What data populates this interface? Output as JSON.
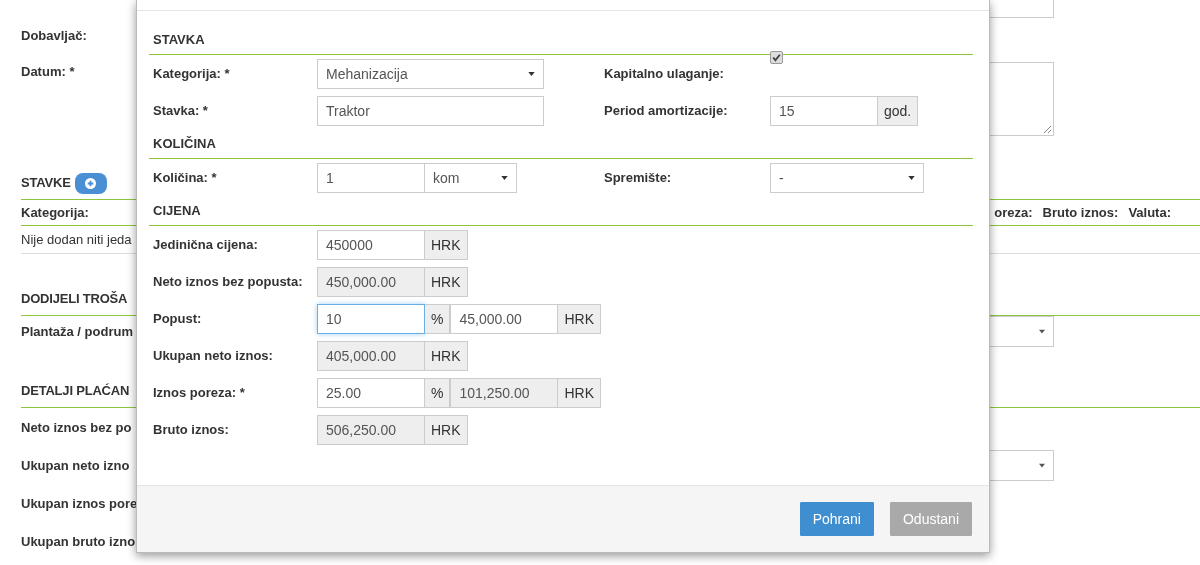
{
  "page": {
    "rows": [
      {
        "kind": "input"
      },
      {
        "kind": "label",
        "label": "Dobavljač:"
      },
      {
        "kind": "textarea",
        "label": "Datum: *"
      },
      {
        "kind": "heading",
        "title": "STAVKE",
        "add_button": true
      },
      {
        "kind": "columns",
        "columns": [
          "Kategorija:",
          "oreza:",
          "Bruto iznos:",
          "Valuta:"
        ]
      },
      {
        "kind": "empty",
        "text": "Nije dodan niti jeda"
      },
      {
        "kind": "heading",
        "title": "DODIJELI TROŠA"
      },
      {
        "kind": "select",
        "label": "Plantaža / podrum"
      },
      {
        "kind": "heading",
        "title": "DETALJI PLAĆAN"
      },
      {
        "kind": "label",
        "label": "Neto iznos bez po"
      },
      {
        "kind": "select",
        "label": "Ukupan neto izno"
      },
      {
        "kind": "label",
        "label": "Ukupan iznos pore"
      },
      {
        "kind": "label",
        "label": "Ukupan bruto izno"
      }
    ]
  },
  "modal": {
    "sections": [
      {
        "title": "STAVKA",
        "rows": [
          {
            "label": "Kategorija: *",
            "groups": [
              [
                {
                  "kind": "select",
                  "value": "Mehanizacija"
                }
              ]
            ],
            "side": {
              "label": "Kapitalno ulaganje:",
              "groups": [
                [
                  {
                    "kind": "checkbox",
                    "checked": true
                  }
                ]
              ]
            }
          },
          {
            "label": "Stavka: *",
            "groups": [
              [
                {
                  "kind": "input",
                  "value": "Traktor",
                  "readonly": false,
                  "focused": false
                }
              ]
            ],
            "side": {
              "label": "Period amortizacije:",
              "groups": [
                [
                  {
                    "kind": "input",
                    "value": "15",
                    "readonly": false,
                    "focused": false
                  },
                  {
                    "kind": "addon",
                    "text": "god."
                  }
                ]
              ]
            }
          }
        ]
      },
      {
        "title": "KOLIČINA",
        "rows": [
          {
            "label": "Količina: *",
            "groups": [
              [
                {
                  "kind": "input",
                  "value": "1",
                  "readonly": false,
                  "focused": false
                },
                {
                  "kind": "unit-select",
                  "value": "kom"
                }
              ]
            ],
            "side": {
              "label": "Spremište:",
              "groups": [
                [
                  {
                    "kind": "select",
                    "value": "-"
                  }
                ]
              ]
            }
          }
        ]
      },
      {
        "title": "CIJENA",
        "rows": [
          {
            "label": "Jedinična cijena:",
            "groups": [
              [
                {
                  "kind": "input",
                  "value": "450000",
                  "readonly": false,
                  "focused": false
                },
                {
                  "kind": "addon",
                  "text": "HRK"
                }
              ]
            ]
          },
          {
            "label": "Neto iznos bez popusta:",
            "groups": [
              [
                {
                  "kind": "input",
                  "value": "450,000.00",
                  "readonly": true,
                  "focused": false
                },
                {
                  "kind": "addon",
                  "text": "HRK"
                }
              ]
            ]
          },
          {
            "label": "Popust:",
            "groups": [
              [
                {
                  "kind": "input",
                  "value": "10",
                  "readonly": false,
                  "focused": true
                },
                {
                  "kind": "addon",
                  "text": "%"
                }
              ],
              [
                {
                  "kind": "input",
                  "value": "45,000.00",
                  "readonly": false,
                  "focused": false
                },
                {
                  "kind": "addon",
                  "text": "HRK"
                }
              ]
            ]
          },
          {
            "label": "Ukupan neto iznos:",
            "groups": [
              [
                {
                  "kind": "input",
                  "value": "405,000.00",
                  "readonly": true,
                  "focused": false
                },
                {
                  "kind": "addon",
                  "text": "HRK"
                }
              ]
            ]
          },
          {
            "label": "Iznos poreza: *",
            "groups": [
              [
                {
                  "kind": "input",
                  "value": "25.00",
                  "readonly": false,
                  "focused": false
                },
                {
                  "kind": "addon",
                  "text": "%"
                }
              ],
              [
                {
                  "kind": "input",
                  "value": "101,250.00",
                  "readonly": true,
                  "focused": false
                },
                {
                  "kind": "addon",
                  "text": "HRK"
                }
              ]
            ]
          },
          {
            "label": "Bruto iznos:",
            "groups": [
              [
                {
                  "kind": "input",
                  "value": "506,250.00",
                  "readonly": true,
                  "focused": false
                },
                {
                  "kind": "addon",
                  "text": "HRK"
                }
              ]
            ]
          }
        ]
      }
    ],
    "buttons": [
      {
        "label": "Pohrani",
        "kind": "primary",
        "disabled": false
      },
      {
        "label": "Odustani",
        "kind": "default",
        "disabled": true
      }
    ]
  }
}
